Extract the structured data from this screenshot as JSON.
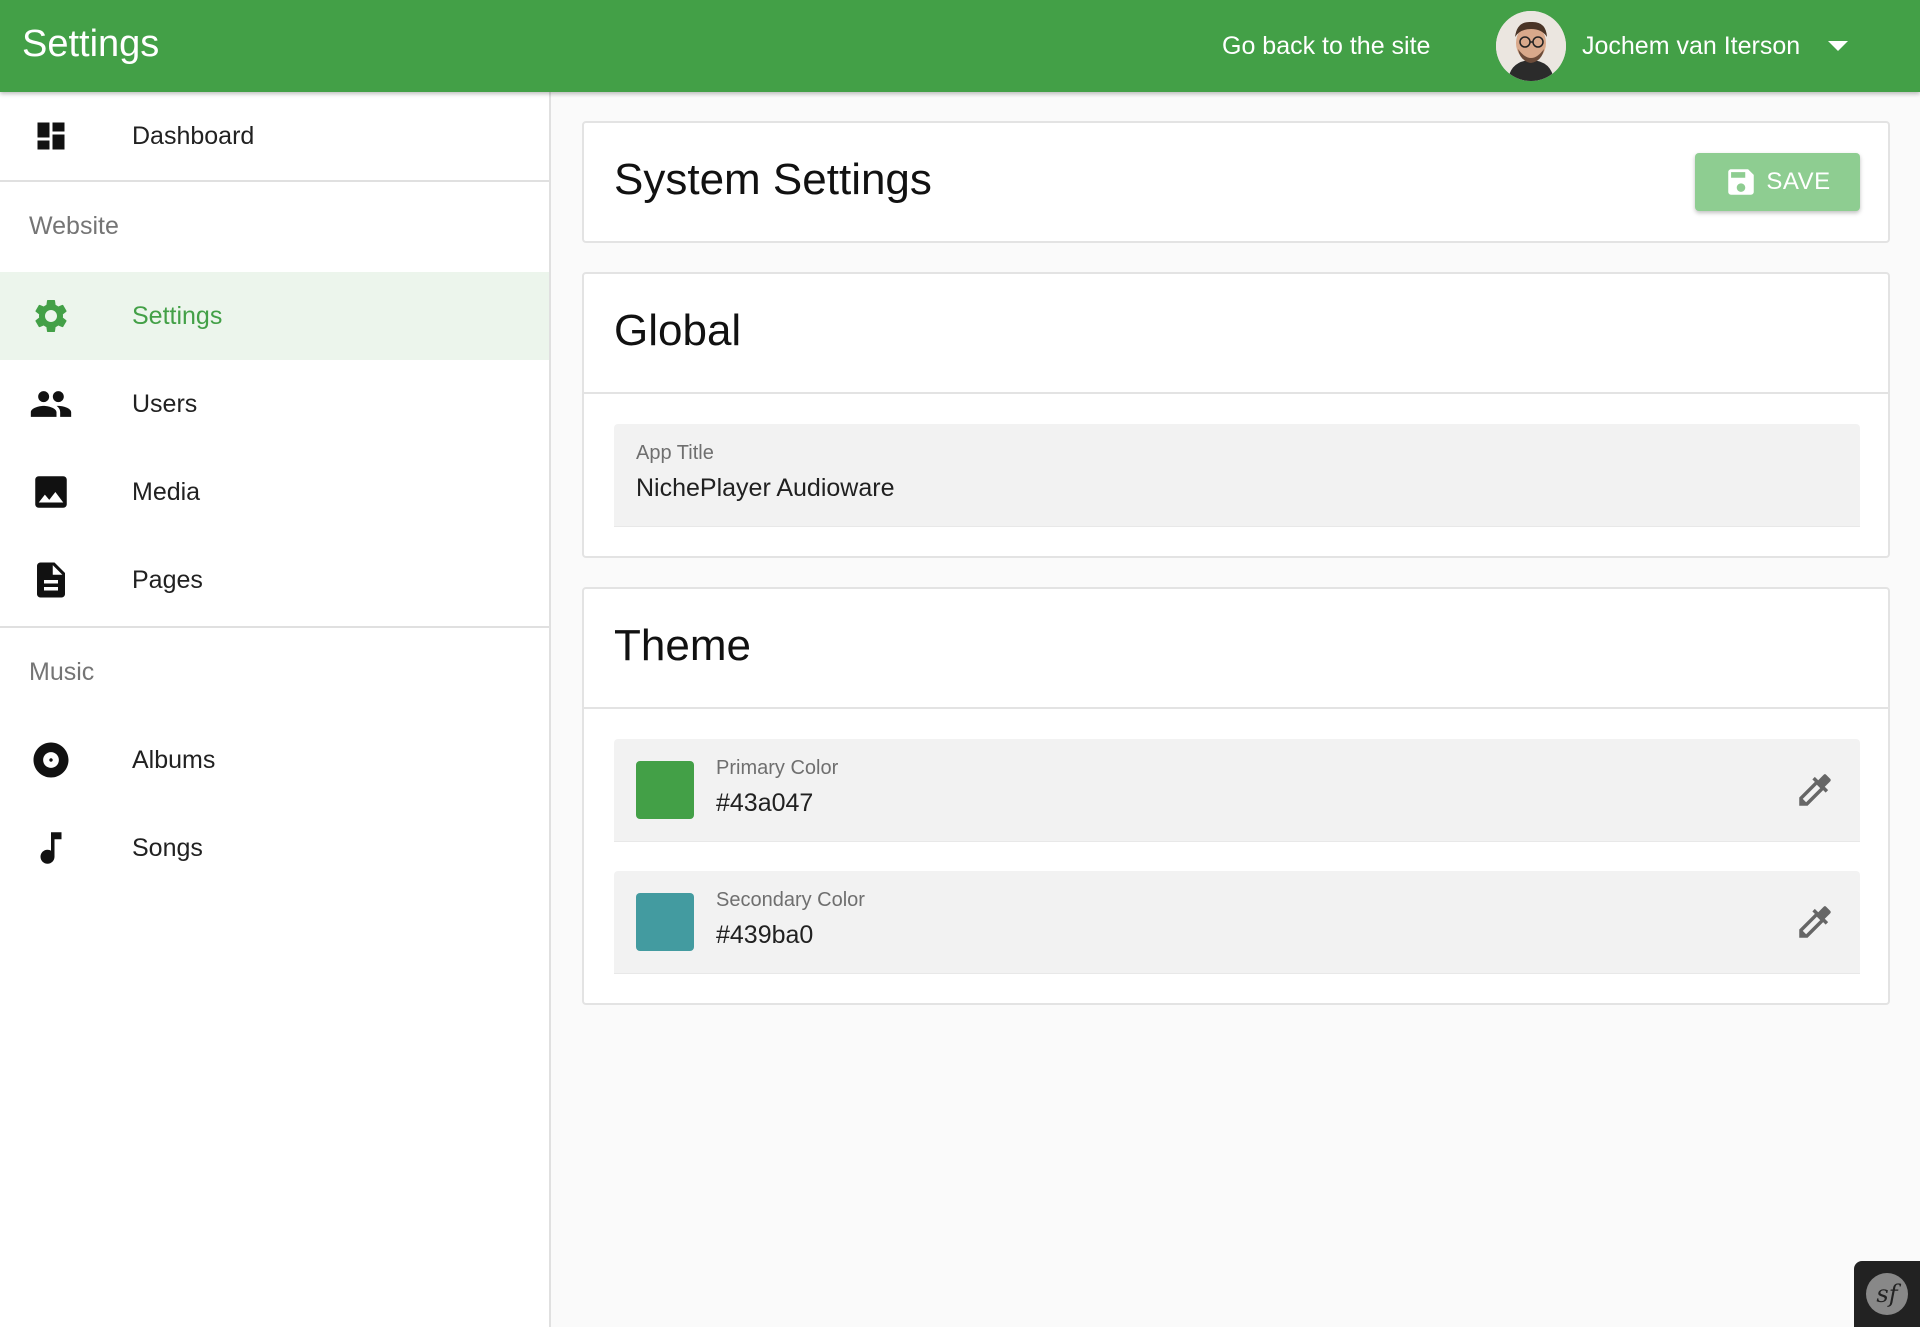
{
  "colors": {
    "primary": "#43a047",
    "secondary": "#439ba0"
  },
  "topbar": {
    "title": "Settings",
    "back_link": "Go back to the site",
    "user_name": "Jochem van Iterson"
  },
  "sidebar": {
    "items": [
      {
        "label": "Dashboard",
        "icon": "dashboard-icon"
      },
      {
        "label": "Settings",
        "icon": "gear-icon",
        "active": true
      },
      {
        "label": "Users",
        "icon": "users-icon"
      },
      {
        "label": "Media",
        "icon": "image-icon"
      },
      {
        "label": "Pages",
        "icon": "document-icon"
      },
      {
        "label": "Albums",
        "icon": "album-icon"
      },
      {
        "label": "Songs",
        "icon": "music-note-icon"
      }
    ],
    "sections": {
      "website": "Website",
      "music": "Music"
    }
  },
  "main": {
    "header": {
      "title": "System Settings",
      "save_label": "SAVE"
    },
    "global": {
      "title": "Global",
      "app_title_label": "App Title",
      "app_title_value": "NichePlayer Audioware"
    },
    "theme": {
      "title": "Theme",
      "primary_label": "Primary Color",
      "primary_value": "#43a047",
      "secondary_label": "Secondary Color",
      "secondary_value": "#439ba0"
    }
  },
  "badge": {
    "icon": "symfony-icon",
    "text": "sf"
  }
}
